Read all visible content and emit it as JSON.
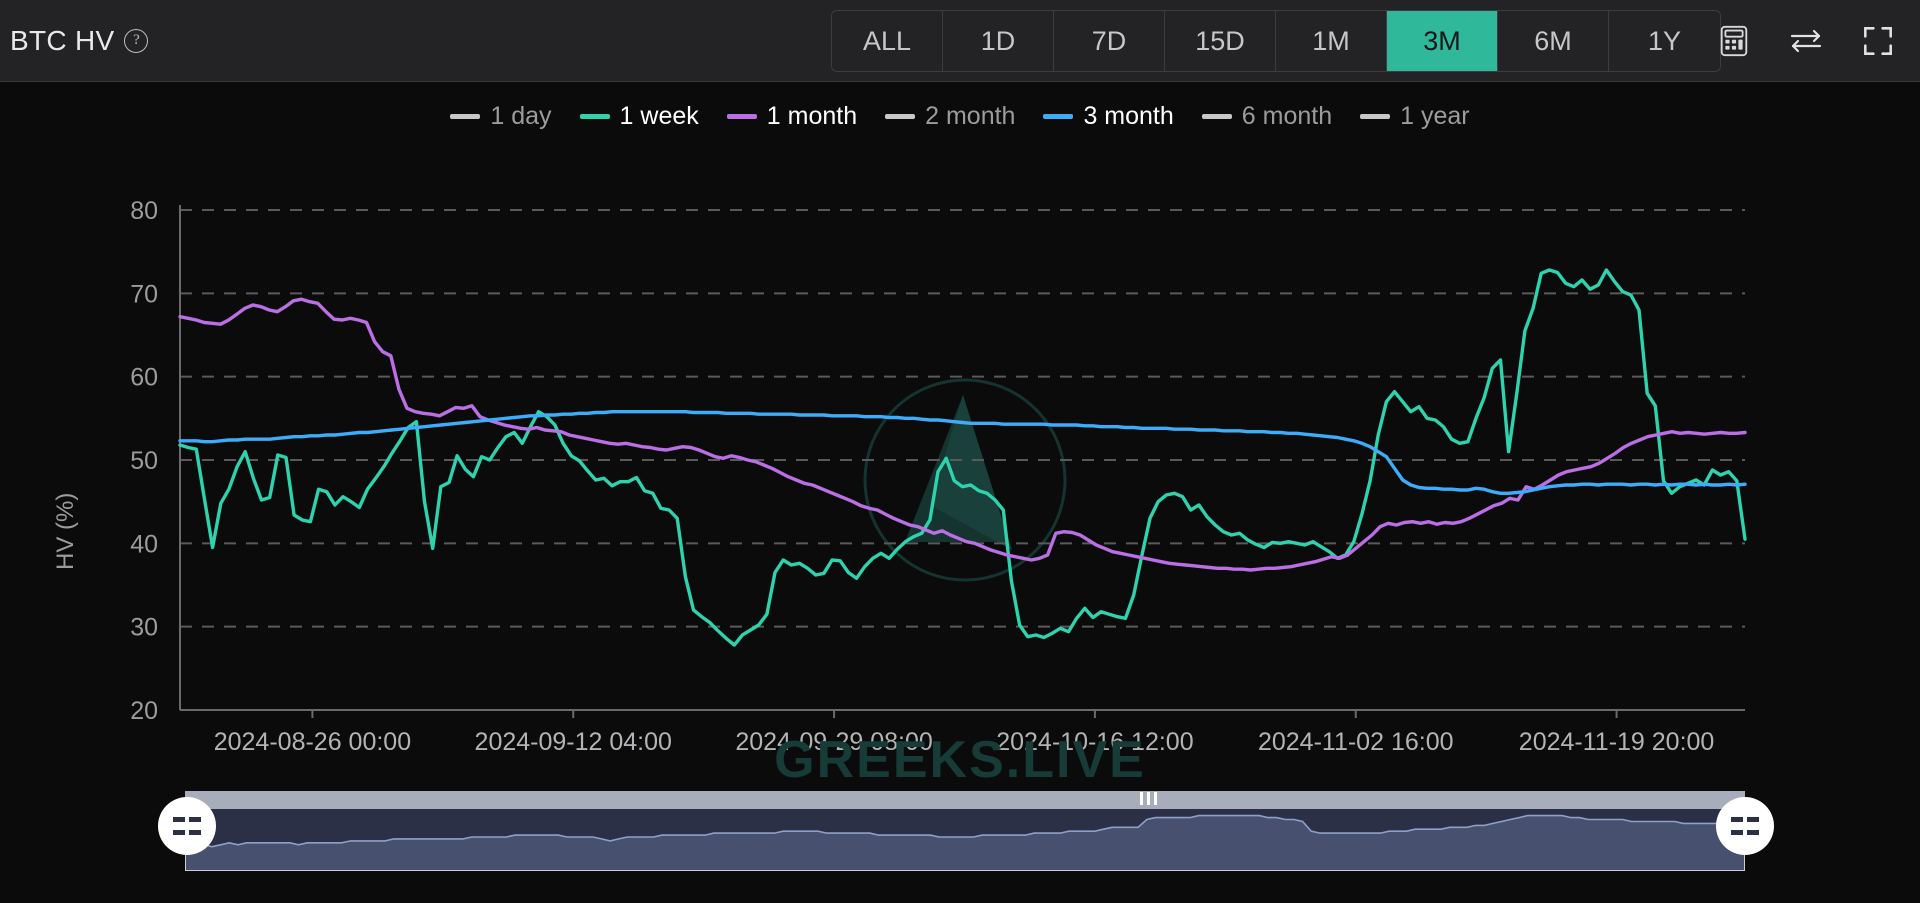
{
  "header": {
    "title": "BTC HV",
    "help_icon": "question-circle-icon",
    "tabs": [
      {
        "label": "ALL",
        "active": false
      },
      {
        "label": "1D",
        "active": false
      },
      {
        "label": "7D",
        "active": false
      },
      {
        "label": "15D",
        "active": false
      },
      {
        "label": "1M",
        "active": false
      },
      {
        "label": "3M",
        "active": true
      },
      {
        "label": "6M",
        "active": false
      },
      {
        "label": "1Y",
        "active": false
      }
    ],
    "icons": [
      {
        "name": "calculator-icon"
      },
      {
        "name": "swap-arrows-icon"
      },
      {
        "name": "fullscreen-icon"
      }
    ],
    "active_color": "#2fb99a",
    "background": "#232325"
  },
  "legend": [
    {
      "label": "1 day",
      "color": "#c9c9cb",
      "active": false
    },
    {
      "label": "1 week",
      "color": "#2ed3ae",
      "active": true
    },
    {
      "label": "1 month",
      "color": "#bb6fe4",
      "active": true
    },
    {
      "label": "2 month",
      "color": "#c9c9cb",
      "active": false
    },
    {
      "label": "3 month",
      "color": "#3dacfa",
      "active": true
    },
    {
      "label": "6 month",
      "color": "#c9c9cb",
      "active": false
    },
    {
      "label": "1 year",
      "color": "#c9c9cb",
      "active": false
    }
  ],
  "watermark": {
    "text": "GREEKS.LIVE",
    "color": "#173b36",
    "logo": "greeks-live-triangle-logo"
  },
  "brush": {
    "handle_left": "datazoom-handle-left",
    "handle_right": "datazoom-handle-right",
    "series_color": "#6d7ea8",
    "fill_color": "#4a5472"
  },
  "chart_data": {
    "type": "line",
    "title": "BTC HV",
    "xlabel": "",
    "ylabel": "HV (%)",
    "ylim": [
      20,
      80
    ],
    "yticks": [
      80,
      70,
      60,
      50,
      40,
      30,
      20
    ],
    "grid": true,
    "legend_position": "top-center",
    "xtick_labels": [
      "2024-08-26 00:00",
      "2024-09-12 04:00",
      "2024-09-29 08:00",
      "2024-10-16 12:00",
      "2024-11-02 16:00",
      "2024-11-19 20:00"
    ],
    "x_start": "2024-08-26 00:00",
    "x_end": "2024-11-28 00:00",
    "series": [
      {
        "name": "1 week",
        "color": "#2ed3ae",
        "visible": true,
        "values": [
          51.8,
          51.5,
          51.3,
          45.3,
          39.5,
          44.8,
          46.5,
          49.2,
          51.0,
          47.8,
          45.2,
          45.5,
          50.6,
          50.3,
          43.4,
          42.8,
          42.6,
          46.5,
          46.2,
          44.6,
          45.6,
          45.0,
          44.3,
          46.5,
          47.8,
          49.2,
          50.8,
          52.3,
          53.9,
          54.6,
          45.0,
          39.4,
          46.8,
          47.3,
          50.5,
          48.9,
          48.0,
          50.4,
          50.0,
          51.5,
          52.8,
          53.3,
          52.0,
          54.0,
          55.8,
          55.2,
          54.2,
          52.0,
          50.5,
          49.9,
          48.7,
          47.6,
          47.8,
          46.9,
          47.4,
          47.4,
          47.9,
          46.3,
          46.0,
          44.2,
          44.0,
          43.0,
          36.0,
          32.0,
          31.2,
          30.5,
          29.5,
          28.6,
          27.8,
          29.0,
          29.6,
          30.2,
          31.5,
          36.5,
          38.0,
          37.4,
          37.6,
          37.0,
          36.2,
          36.4,
          38.0,
          37.9,
          36.5,
          35.8,
          37.2,
          38.2,
          38.8,
          38.2,
          39.3,
          40.2,
          40.8,
          41.2,
          42.8,
          48.6,
          50.2,
          47.5,
          46.8,
          47.0,
          46.3,
          46.0,
          45.2,
          44.0,
          35.5,
          30.2,
          28.8,
          29.0,
          28.7,
          29.2,
          29.8,
          29.4,
          31.0,
          32.2,
          31.1,
          31.8,
          31.5,
          31.2,
          31.0,
          33.8,
          38.5,
          43.0,
          45.0,
          45.8,
          46.0,
          45.6,
          44.0,
          44.6,
          43.2,
          42.2,
          41.4,
          41.0,
          41.2,
          40.4,
          39.9,
          39.5,
          40.1,
          40.0,
          40.2,
          40.0,
          39.8,
          40.2,
          39.6,
          39.0,
          38.2,
          38.6,
          40.2,
          43.5,
          47.5,
          53.0,
          57.0,
          58.2,
          57.0,
          55.8,
          56.4,
          55.0,
          54.8,
          54.0,
          52.5,
          52.0,
          52.2,
          55.0,
          57.5,
          61.0,
          62.0,
          51.0,
          58.0,
          65.5,
          68.2,
          72.4,
          72.8,
          72.5,
          71.2,
          70.8,
          71.6,
          70.5,
          71.0,
          72.8,
          71.4,
          70.2,
          69.8,
          68.0,
          58.0,
          56.5,
          47.5,
          46.0,
          46.8,
          47.2,
          47.6,
          47.0,
          48.8,
          48.2,
          48.6,
          47.5,
          40.5
        ]
      },
      {
        "name": "1 month",
        "color": "#bb6fe4",
        "visible": true,
        "values": [
          67.2,
          67.0,
          66.8,
          66.5,
          66.4,
          66.3,
          66.8,
          67.5,
          68.2,
          68.6,
          68.4,
          68.0,
          67.8,
          68.4,
          69.1,
          69.3,
          69.0,
          68.8,
          67.8,
          66.9,
          66.8,
          67.0,
          66.8,
          66.5,
          64.2,
          63.0,
          62.5,
          58.5,
          56.2,
          55.8,
          55.6,
          55.5,
          55.3,
          55.8,
          56.3,
          56.2,
          56.5,
          55.2,
          54.8,
          54.5,
          54.2,
          54.0,
          53.8,
          53.7,
          53.9,
          53.6,
          53.5,
          53.4,
          53.0,
          52.8,
          52.6,
          52.4,
          52.2,
          52.0,
          51.9,
          52.0,
          51.8,
          51.6,
          51.5,
          51.3,
          51.2,
          51.4,
          51.6,
          51.5,
          51.2,
          50.8,
          50.4,
          50.2,
          50.5,
          50.3,
          50.0,
          49.8,
          49.4,
          49.0,
          48.5,
          48.0,
          47.6,
          47.2,
          47.0,
          46.6,
          46.2,
          45.8,
          45.4,
          45.0,
          44.5,
          44.2,
          44.0,
          43.5,
          43.0,
          42.6,
          42.2,
          42.0,
          41.6,
          41.2,
          41.5,
          41.0,
          40.6,
          40.2,
          40.0,
          39.6,
          39.2,
          38.9,
          38.6,
          38.4,
          38.2,
          38.0,
          38.2,
          38.6,
          41.2,
          41.4,
          41.3,
          41.0,
          40.4,
          39.8,
          39.4,
          39.0,
          38.8,
          38.6,
          38.4,
          38.2,
          38.0,
          37.8,
          37.6,
          37.5,
          37.4,
          37.3,
          37.2,
          37.1,
          37.0,
          37.0,
          36.9,
          36.9,
          36.8,
          36.9,
          37.0,
          37.0,
          37.1,
          37.2,
          37.4,
          37.6,
          37.8,
          38.1,
          38.4,
          38.2,
          38.6,
          39.4,
          40.2,
          41.0,
          42.0,
          42.4,
          42.2,
          42.5,
          42.6,
          42.4,
          42.6,
          42.3,
          42.5,
          42.4,
          42.6,
          43.0,
          43.5,
          44.0,
          44.5,
          44.8,
          45.4,
          45.2,
          46.8,
          46.5,
          47.0,
          47.6,
          48.2,
          48.6,
          48.8,
          49.0,
          49.2,
          49.6,
          50.2,
          50.8,
          51.5,
          52.0,
          52.4,
          52.8,
          53.0,
          53.2,
          53.4,
          53.2,
          53.3,
          53.2,
          53.1,
          53.2,
          53.3,
          53.2,
          53.2,
          53.3
        ]
      },
      {
        "name": "3 month",
        "color": "#3dacfa",
        "visible": true,
        "values": [
          52.3,
          52.3,
          52.3,
          52.2,
          52.2,
          52.3,
          52.4,
          52.4,
          52.5,
          52.5,
          52.5,
          52.5,
          52.6,
          52.7,
          52.8,
          52.8,
          52.9,
          52.9,
          53.0,
          53.0,
          53.1,
          53.2,
          53.3,
          53.3,
          53.4,
          53.5,
          53.6,
          53.7,
          53.8,
          53.9,
          54.0,
          54.1,
          54.2,
          54.3,
          54.4,
          54.5,
          54.6,
          54.7,
          54.8,
          54.9,
          55.0,
          55.1,
          55.2,
          55.3,
          55.3,
          55.4,
          55.4,
          55.5,
          55.5,
          55.6,
          55.6,
          55.7,
          55.7,
          55.8,
          55.8,
          55.8,
          55.8,
          55.8,
          55.8,
          55.8,
          55.8,
          55.8,
          55.8,
          55.7,
          55.7,
          55.7,
          55.7,
          55.6,
          55.6,
          55.6,
          55.6,
          55.5,
          55.5,
          55.5,
          55.5,
          55.5,
          55.4,
          55.4,
          55.4,
          55.4,
          55.3,
          55.3,
          55.3,
          55.3,
          55.2,
          55.2,
          55.2,
          55.1,
          55.1,
          55.0,
          55.0,
          54.9,
          54.8,
          54.8,
          54.7,
          54.6,
          54.5,
          54.4,
          54.4,
          54.4,
          54.4,
          54.3,
          54.3,
          54.3,
          54.3,
          54.3,
          54.3,
          54.2,
          54.2,
          54.2,
          54.2,
          54.1,
          54.1,
          54.0,
          54.0,
          54.0,
          53.9,
          53.9,
          53.8,
          53.8,
          53.8,
          53.8,
          53.7,
          53.7,
          53.7,
          53.6,
          53.6,
          53.6,
          53.5,
          53.5,
          53.5,
          53.4,
          53.4,
          53.4,
          53.3,
          53.3,
          53.2,
          53.2,
          53.1,
          53.0,
          52.9,
          52.8,
          52.7,
          52.5,
          52.3,
          52.0,
          51.6,
          51.0,
          50.4,
          49.0,
          47.6,
          47.0,
          46.7,
          46.6,
          46.6,
          46.5,
          46.5,
          46.4,
          46.4,
          46.6,
          46.5,
          46.2,
          46.0,
          46.0,
          46.1,
          46.2,
          46.4,
          46.6,
          46.8,
          46.9,
          47.0,
          47.0,
          47.1,
          47.1,
          47.0,
          47.1,
          47.1,
          47.1,
          47.0,
          47.1,
          47.1,
          47.0,
          47.1,
          47.0,
          47.1,
          47.1,
          47.0,
          47.1,
          47.0,
          47.0,
          47.1,
          47.0,
          47.1
        ]
      }
    ],
    "brush_series": {
      "name": "overview",
      "color": "#6d7ea8",
      "values": [
        30,
        34,
        35,
        34,
        35,
        36,
        35,
        36,
        36,
        36,
        36,
        36,
        36,
        35,
        36,
        36,
        36,
        36,
        36,
        37,
        37,
        37,
        37,
        37,
        38,
        38,
        38,
        38,
        38,
        38,
        38,
        38,
        38,
        39,
        39,
        39,
        39,
        39,
        40,
        40,
        40,
        40,
        40,
        40,
        39,
        39,
        39,
        39,
        38,
        37,
        38,
        39,
        39,
        39,
        39,
        40,
        40,
        40,
        40,
        40,
        40,
        41,
        41,
        41,
        41,
        41,
        41,
        41,
        41,
        42,
        42,
        42,
        42,
        42,
        41,
        41,
        41,
        41,
        41,
        41,
        40,
        40,
        40,
        40,
        40,
        40,
        40,
        39,
        39,
        39,
        39,
        39,
        40,
        40,
        40,
        40,
        40,
        40,
        41,
        41,
        41,
        41,
        42,
        42,
        42,
        42,
        43,
        44,
        44,
        44,
        44,
        48,
        49,
        49,
        49,
        49,
        49,
        50,
        50,
        50,
        50,
        50,
        50,
        50,
        50,
        49,
        49,
        48,
        48,
        47,
        42,
        41,
        41,
        41,
        41,
        41,
        41,
        41,
        41,
        42,
        42,
        42,
        43,
        43,
        43,
        43,
        44,
        44,
        44,
        45,
        45,
        46,
        47,
        48,
        49,
        50,
        50,
        50,
        50,
        50,
        49,
        49,
        48,
        48,
        48,
        48,
        48,
        47,
        47,
        47,
        47,
        47,
        47,
        46,
        46,
        46,
        46,
        46,
        46,
        46,
        46
      ]
    }
  }
}
